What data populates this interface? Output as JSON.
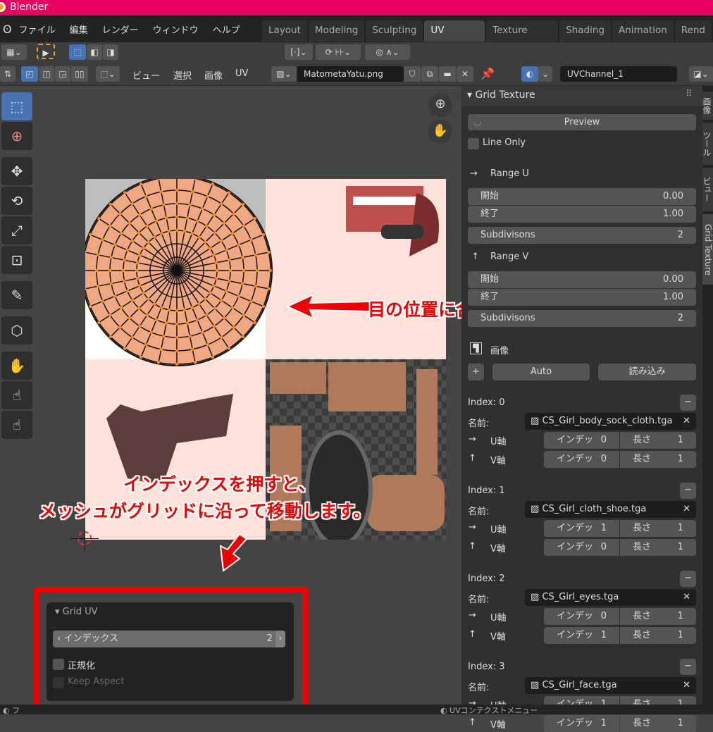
{
  "title": "Blender",
  "menu": [
    "ファイル",
    "編集",
    "レンダー",
    "ウィンドウ",
    "ヘルプ"
  ],
  "workspaces": [
    {
      "label": "Layout"
    },
    {
      "label": "Modeling"
    },
    {
      "label": "Sculpting"
    },
    {
      "label": "UV Editing",
      "active": true
    },
    {
      "label": "Texture Paint"
    },
    {
      "label": "Shading"
    },
    {
      "label": "Animation"
    },
    {
      "label": "Rend"
    }
  ],
  "header": {
    "menus": [
      "ビュー",
      "選択",
      "画像",
      "UV"
    ],
    "image_name": "MatometaYatu.png",
    "uv_channel": "UVChannel_1"
  },
  "panel": {
    "title": "Grid Texture",
    "preview": "Preview",
    "line_only": "Line Only",
    "range_u": {
      "label": "Range U",
      "start_label": "開始",
      "start": "0.00",
      "end_label": "終了",
      "end": "1.00",
      "subdiv_label": "Subdivisons",
      "subdiv": "2"
    },
    "range_v": {
      "label": "Range V",
      "start_label": "開始",
      "start": "0.00",
      "end_label": "終了",
      "end": "1.00",
      "subdiv_label": "Subdivisons",
      "subdiv": "2"
    },
    "image_label": "画像",
    "auto": "Auto",
    "load": "読み込み",
    "name_label": "名前:",
    "u_label": "U軸",
    "v_label": "V軸",
    "index_label": "インデッ",
    "length_label": "長さ",
    "entries": [
      {
        "title": "Index: 0",
        "name": "CS_Girl_body_sock_cloth.tga",
        "u_index": "0",
        "u_len": "1",
        "v_index": "0",
        "v_len": "1"
      },
      {
        "title": "Index: 1",
        "name": "CS_Girl_cloth_shoe.tga",
        "u_index": "1",
        "u_len": "1",
        "v_index": "0",
        "v_len": "1"
      },
      {
        "title": "Index: 2",
        "name": "CS_Girl_eyes.tga",
        "u_index": "0",
        "u_len": "1",
        "v_index": "1",
        "v_len": "1"
      },
      {
        "title": "Index: 3",
        "name": "CS_Girl_face.tga",
        "u_index": "1",
        "u_len": "1",
        "v_index": "1",
        "v_len": "1"
      }
    ]
  },
  "side_tabs": [
    "画像",
    "ツール",
    "ビュー",
    "Grid Texture"
  ],
  "grid_uv": {
    "title": "Grid UV",
    "index_label": "インデックス",
    "index_value": "2",
    "normalize": "正規化",
    "keep_aspect": "Keep Aspect"
  },
  "annotations": {
    "eye": "目の位置に合わせた",
    "line1": "インデックスを押すと、",
    "line2": "メッシュがグリッドに沿って移動します。"
  },
  "status": {
    "left": "フ",
    "right": "UVコンテクストメニュー"
  },
  "colors": {
    "title_bar": "#e8005f",
    "accent": "#4772b3",
    "annotation": "#e00000"
  }
}
